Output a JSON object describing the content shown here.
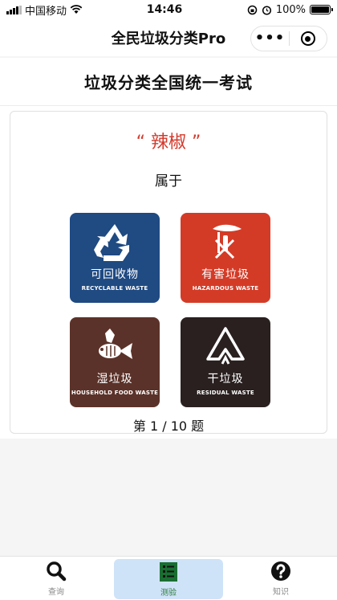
{
  "status_bar": {
    "carrier": "中国移动",
    "time": "14:46",
    "battery_percent": "100%"
  },
  "nav": {
    "title": "全民垃圾分类Pro",
    "more": "•••"
  },
  "page": {
    "title": "垃圾分类全国统一考试"
  },
  "quiz": {
    "word": "“ 辣椒 ”",
    "prompt": "属于",
    "progress": "第 1 / 10 题",
    "bins": [
      {
        "cn": "可回收物",
        "en": "RECYCLABLE WASTE",
        "color": "#1f4a82"
      },
      {
        "cn": "有害垃圾",
        "en": "HAZARDOUS WASTE",
        "color": "#d43b27"
      },
      {
        "cn": "湿垃圾",
        "en": "HOUSEHOLD FOOD WASTE",
        "color": "#5b3229"
      },
      {
        "cn": "干垃圾",
        "en": "RESIDUAL WASTE",
        "color": "#2a2020"
      }
    ]
  },
  "tabs": [
    {
      "label": "查询",
      "icon": "search-icon"
    },
    {
      "label": "测验",
      "icon": "checklist-icon",
      "active": true
    },
    {
      "label": "知识",
      "icon": "question-icon"
    }
  ]
}
